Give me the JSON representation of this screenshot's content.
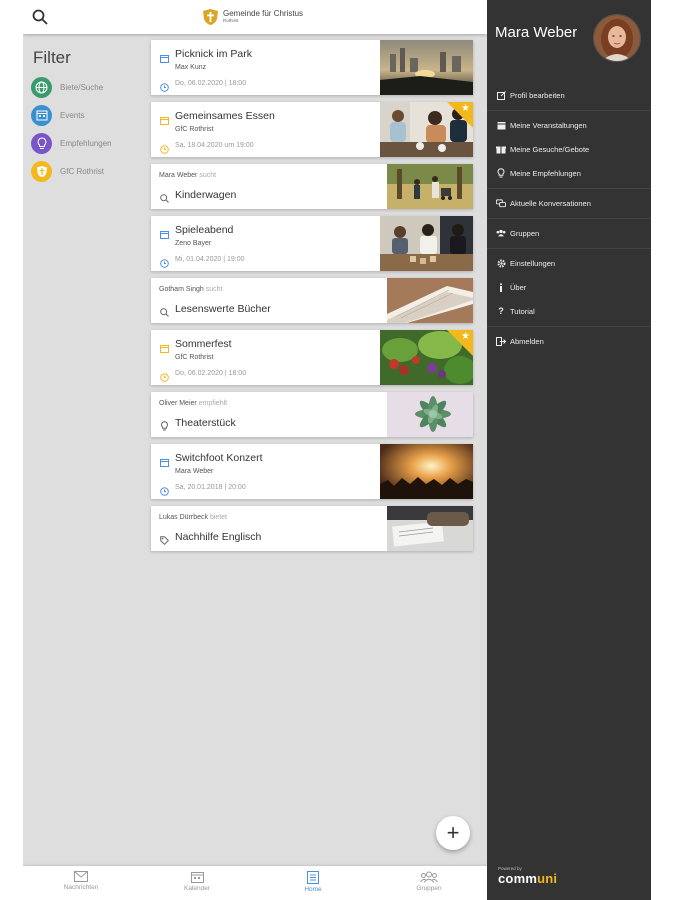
{
  "header": {
    "logo_line1": "Gemeinde für Christus",
    "logo_line2": "Rothrist"
  },
  "filter": {
    "title": "Filter",
    "items": [
      {
        "label": "Biete/Suche",
        "color": "#3a9a6e",
        "icon": "globe-icon"
      },
      {
        "label": "Events",
        "color": "#3a8fd0",
        "icon": "calendar-icon"
      },
      {
        "label": "Empfehlungen",
        "color": "#7a55c8",
        "icon": "lightbulb-icon"
      },
      {
        "label": "GfC Rothrist",
        "color": "#f3b81c",
        "icon": "church-icon"
      }
    ]
  },
  "feed": [
    {
      "kind": "event",
      "title": "Picknick im Park",
      "sub": "Max Kunz",
      "date": "Do, 06.02.2020 | 18:00",
      "featured": false,
      "icon_color": "#4a90e2"
    },
    {
      "kind": "event",
      "title": "Gemeinsames Essen",
      "sub": "GfC Rothrist",
      "date": "Sa, 18.04.2020 um 19:00",
      "featured": true,
      "icon_color": "#f3b81c"
    },
    {
      "kind": "search",
      "who": "Mara Weber",
      "verb": "sucht",
      "title": "Kinderwagen"
    },
    {
      "kind": "event",
      "title": "Spieleabend",
      "sub": "Zeno Bayer",
      "date": "Mi, 01.04.2020 | 19:00",
      "featured": false,
      "icon_color": "#4a90e2"
    },
    {
      "kind": "search",
      "who": "Gotham Singh",
      "verb": "sucht",
      "title": "Lesenswerte Bücher"
    },
    {
      "kind": "event",
      "title": "Sommerfest",
      "sub": "GfC Rothrist",
      "date": "Do, 06.02.2020 | 18:00",
      "featured": true,
      "icon_color": "#f3b81c"
    },
    {
      "kind": "recommend",
      "who": "Oliver Meier",
      "verb": "empfiehlt",
      "title": "Theaterstück"
    },
    {
      "kind": "event",
      "title": "Switchfoot Konzert",
      "sub": "Mara Weber",
      "date": "Sa, 20.01.2018 | 20:00",
      "featured": false,
      "icon_color": "#4a90e2"
    },
    {
      "kind": "offer",
      "who": "Lukas Dürrbeck",
      "verb": "bietet",
      "title": "Nachhilfe Englisch"
    }
  ],
  "tabs": [
    {
      "label": "Nachrichten",
      "icon": "mail-icon",
      "active": false
    },
    {
      "label": "Kalender",
      "icon": "calendar-icon",
      "active": false
    },
    {
      "label": "Home",
      "icon": "home-icon",
      "active": true
    },
    {
      "label": "Gruppen",
      "icon": "groups-icon",
      "active": false
    }
  ],
  "drawer": {
    "user_name": "Mara Weber",
    "menu": [
      {
        "label": "Profil bearbeiten",
        "icon": "edit-icon"
      },
      {
        "label": "Meine Veranstaltungen",
        "icon": "calendar-icon"
      },
      {
        "label": "Meine Gesuche/Gebote",
        "icon": "gift-icon"
      },
      {
        "label": "Meine Empfehlungen",
        "icon": "lightbulb-icon"
      },
      {
        "label": "Aktuelle Konversationen",
        "icon": "chat-icon"
      },
      {
        "label": "Gruppen",
        "icon": "groups-icon"
      },
      {
        "label": "Einstellungen",
        "icon": "gear-icon"
      },
      {
        "label": "Über",
        "icon": "info-icon"
      },
      {
        "label": "Tutorial",
        "icon": "question-icon"
      },
      {
        "label": "Abmelden",
        "icon": "logout-icon"
      }
    ],
    "brand_powered": "Powered by",
    "brand_name_a": "comm",
    "brand_name_b": "uni"
  }
}
